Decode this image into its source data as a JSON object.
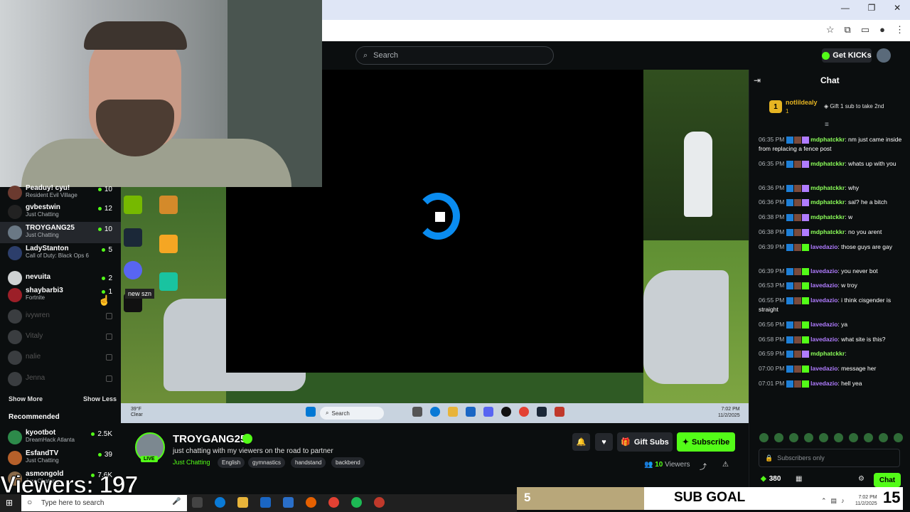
{
  "browser": {
    "window_controls": [
      "—",
      "❐",
      "✕"
    ]
  },
  "header": {
    "search_placeholder": "Search",
    "get_kicks_label": "Get KICKs"
  },
  "sidebar": {
    "channels": [
      {
        "name": "Peaduy! cyu!",
        "game": "Resident Evil Village",
        "count": "10",
        "color": "#6b3a2f",
        "online": true
      },
      {
        "name": "gvbestwin",
        "game": "Just Chatting",
        "count": "12",
        "color": "#222",
        "online": true
      },
      {
        "name": "TROYGANG25",
        "game": "Just Chatting",
        "count": "10",
        "color": "#6a7885",
        "online": true,
        "active": true
      },
      {
        "name": "LadyStanton",
        "game": "Call of Duty: Black Ops 6",
        "count": "5",
        "color": "#2c3e6b",
        "online": true
      },
      {
        "name": "nevuita",
        "game": "",
        "count": "2",
        "color": "#cfd2d3",
        "online": true
      },
      {
        "name": "shaybarbi3",
        "game": "Fortnite",
        "count": "1",
        "color": "#9c1f28",
        "online": true
      },
      {
        "name": "ivywren",
        "game": "",
        "count": "",
        "color": "#3a3d40",
        "online": false
      },
      {
        "name": "Vitaly",
        "game": "",
        "count": "",
        "color": "#3a3d40",
        "online": false
      },
      {
        "name": "nalie",
        "game": "",
        "count": "",
        "color": "#3a3d40",
        "online": false
      },
      {
        "name": "Jenna",
        "game": "",
        "count": "",
        "color": "#3a3d40",
        "online": false
      }
    ],
    "show_more": "Show More",
    "show_less": "Show Less",
    "recommended_heading": "Recommended",
    "recommended": [
      {
        "name": "kyootbot",
        "game": "DreamHack Atlanta",
        "count": "2.5K",
        "color": "#2d8a4a"
      },
      {
        "name": "EsfandTV",
        "game": "Just Chatting",
        "count": "39",
        "color": "#b5602a"
      },
      {
        "name": "asmongold",
        "game": "Just Chatting",
        "count": "7.6K",
        "color": "#8a6a4a"
      }
    ]
  },
  "video": {
    "tooltip": "new szn",
    "inner_taskbar": {
      "weather": "39°F\nClear",
      "search": "Search",
      "time": "7:02 PM\n11/2/2025"
    }
  },
  "stream": {
    "streamer_name": "TROYGANG25",
    "live_label": "LIVE",
    "title": "just chatting with my viewers on the road to partner",
    "category": "Just Chatting",
    "tags": [
      "English",
      "gymnastics",
      "handstand",
      "backbend"
    ],
    "gift_subs_label": "Gift Subs",
    "subscribe_label": "Subscribe",
    "viewer_count": "10",
    "viewers_label": "Viewers"
  },
  "chat": {
    "title": "Chat",
    "pinned": {
      "rank": "1",
      "name": "notlildealy",
      "count": "1",
      "gift_hint": "Gift 1 sub to take 2nd"
    },
    "messages": [
      {
        "time": "06:35 PM",
        "user": "mdphatckkr",
        "text": ": nm just came inside from replacing a fence post",
        "color": "u1",
        "badge": "#b07cff"
      },
      {
        "time": "06:35 PM",
        "user": "mdphatckkr",
        "text": ": whats up with you",
        "color": "u1",
        "badge": "#b07cff"
      },
      {
        "time": "06:36 PM",
        "user": "mdphatckkr",
        "text": ": why",
        "color": "u1",
        "badge": "#b07cff"
      },
      {
        "time": "06:36 PM",
        "user": "mdphatckkr",
        "text": ": sal? he a bitch",
        "color": "u1",
        "badge": "#b07cff"
      },
      {
        "time": "06:38 PM",
        "user": "mdphatckkr",
        "text": ": w",
        "color": "u1",
        "badge": "#b07cff"
      },
      {
        "time": "06:38 PM",
        "user": "mdphatckkr",
        "text": ": no you arent",
        "color": "u1",
        "badge": "#b07cff"
      },
      {
        "time": "06:39 PM",
        "user": "lavedazio",
        "text": ": those guys are gay",
        "color": "u2",
        "badge": "#53fc18"
      },
      {
        "time": "06:39 PM",
        "user": "lavedazio",
        "text": ": you never bot",
        "color": "u2",
        "badge": "#53fc18"
      },
      {
        "time": "06:53 PM",
        "user": "lavedazio",
        "text": ": w troy",
        "color": "u2",
        "badge": "#53fc18"
      },
      {
        "time": "06:55 PM",
        "user": "lavedazio",
        "text": ": i think cisgender is straight",
        "color": "u2",
        "badge": "#53fc18"
      },
      {
        "time": "06:56 PM",
        "user": "lavedazio",
        "text": ": ya",
        "color": "u2",
        "badge": "#53fc18"
      },
      {
        "time": "06:58 PM",
        "user": "lavedazio",
        "text": ": what site is this?",
        "color": "u2",
        "badge": "#53fc18"
      },
      {
        "time": "06:59 PM",
        "user": "mdphatckkr",
        "text": ":",
        "color": "u1",
        "badge": "#b07cff"
      },
      {
        "time": "07:00 PM",
        "user": "lavedazio",
        "text": ": message her",
        "color": "u2",
        "badge": "#53fc18"
      },
      {
        "time": "07:01 PM",
        "user": "lavedazio",
        "text": ": hell yea",
        "color": "u2",
        "badge": "#53fc18"
      }
    ],
    "input_placeholder": "Subscribers only",
    "kicks_count": "380",
    "chat_button": "Chat"
  },
  "overlay": {
    "viewers_text": "Viewers: 197",
    "sub_goal_current": "5",
    "sub_goal_label": "SUB GOAL",
    "sub_goal_target": "15",
    "sub_goal_progress": 0.33
  },
  "os_taskbar": {
    "search_placeholder": "Type here to search",
    "time": "7:02 PM\n11/2/2025"
  }
}
